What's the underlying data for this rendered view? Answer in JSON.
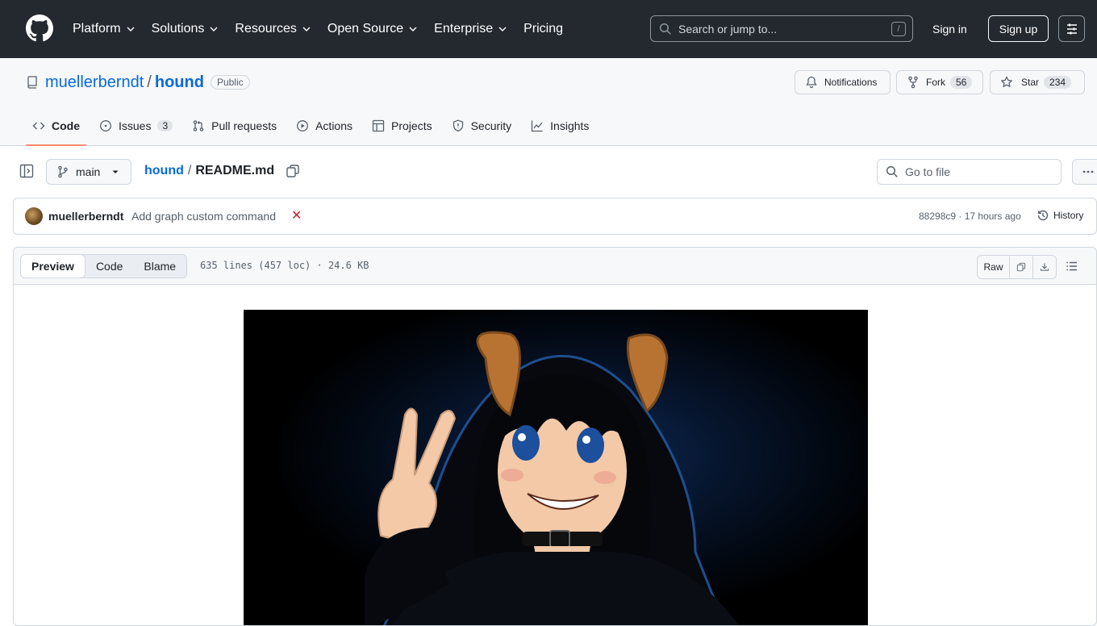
{
  "header": {
    "nav": [
      {
        "label": "Platform",
        "has_menu": true
      },
      {
        "label": "Solutions",
        "has_menu": true
      },
      {
        "label": "Resources",
        "has_menu": true
      },
      {
        "label": "Open Source",
        "has_menu": true
      },
      {
        "label": "Enterprise",
        "has_menu": true
      },
      {
        "label": "Pricing",
        "has_menu": false
      }
    ],
    "search_placeholder": "Search or jump to...",
    "search_shortcut": "/",
    "sign_in": "Sign in",
    "sign_up": "Sign up"
  },
  "repo": {
    "owner": "muellerberndt",
    "separator": "/",
    "name": "hound",
    "visibility": "Public",
    "notifications_label": "Notifications",
    "fork_label": "Fork",
    "fork_count": "56",
    "star_label": "Star",
    "star_count": "234",
    "tabs": [
      {
        "label": "Code",
        "icon": "code-icon",
        "active": true
      },
      {
        "label": "Issues",
        "icon": "issue-icon",
        "count": "3"
      },
      {
        "label": "Pull requests",
        "icon": "pull-request-icon"
      },
      {
        "label": "Actions",
        "icon": "play-icon"
      },
      {
        "label": "Projects",
        "icon": "table-icon"
      },
      {
        "label": "Security",
        "icon": "shield-icon"
      },
      {
        "label": "Insights",
        "icon": "graph-icon"
      }
    ]
  },
  "file_bar": {
    "branch": "main",
    "crumb_repo": "hound",
    "crumb_sep": "/",
    "crumb_file": "README.md",
    "goto_placeholder": "Go to file"
  },
  "commit": {
    "author": "muellerberndt",
    "message": "Add graph custom command",
    "status": "✕",
    "meta": "88298c9 · 17 hours ago",
    "history": "History"
  },
  "viewer": {
    "tabs": [
      "Preview",
      "Code",
      "Blame"
    ],
    "active_tab": "Preview",
    "file_info": "635 lines (457 loc) · 24.6 KB",
    "raw_label": "Raw"
  },
  "colors": {
    "header_bg": "#24292f",
    "link": "#0969da",
    "active_tab_underline": "#fd8c73",
    "fail_red": "#cf222e"
  }
}
